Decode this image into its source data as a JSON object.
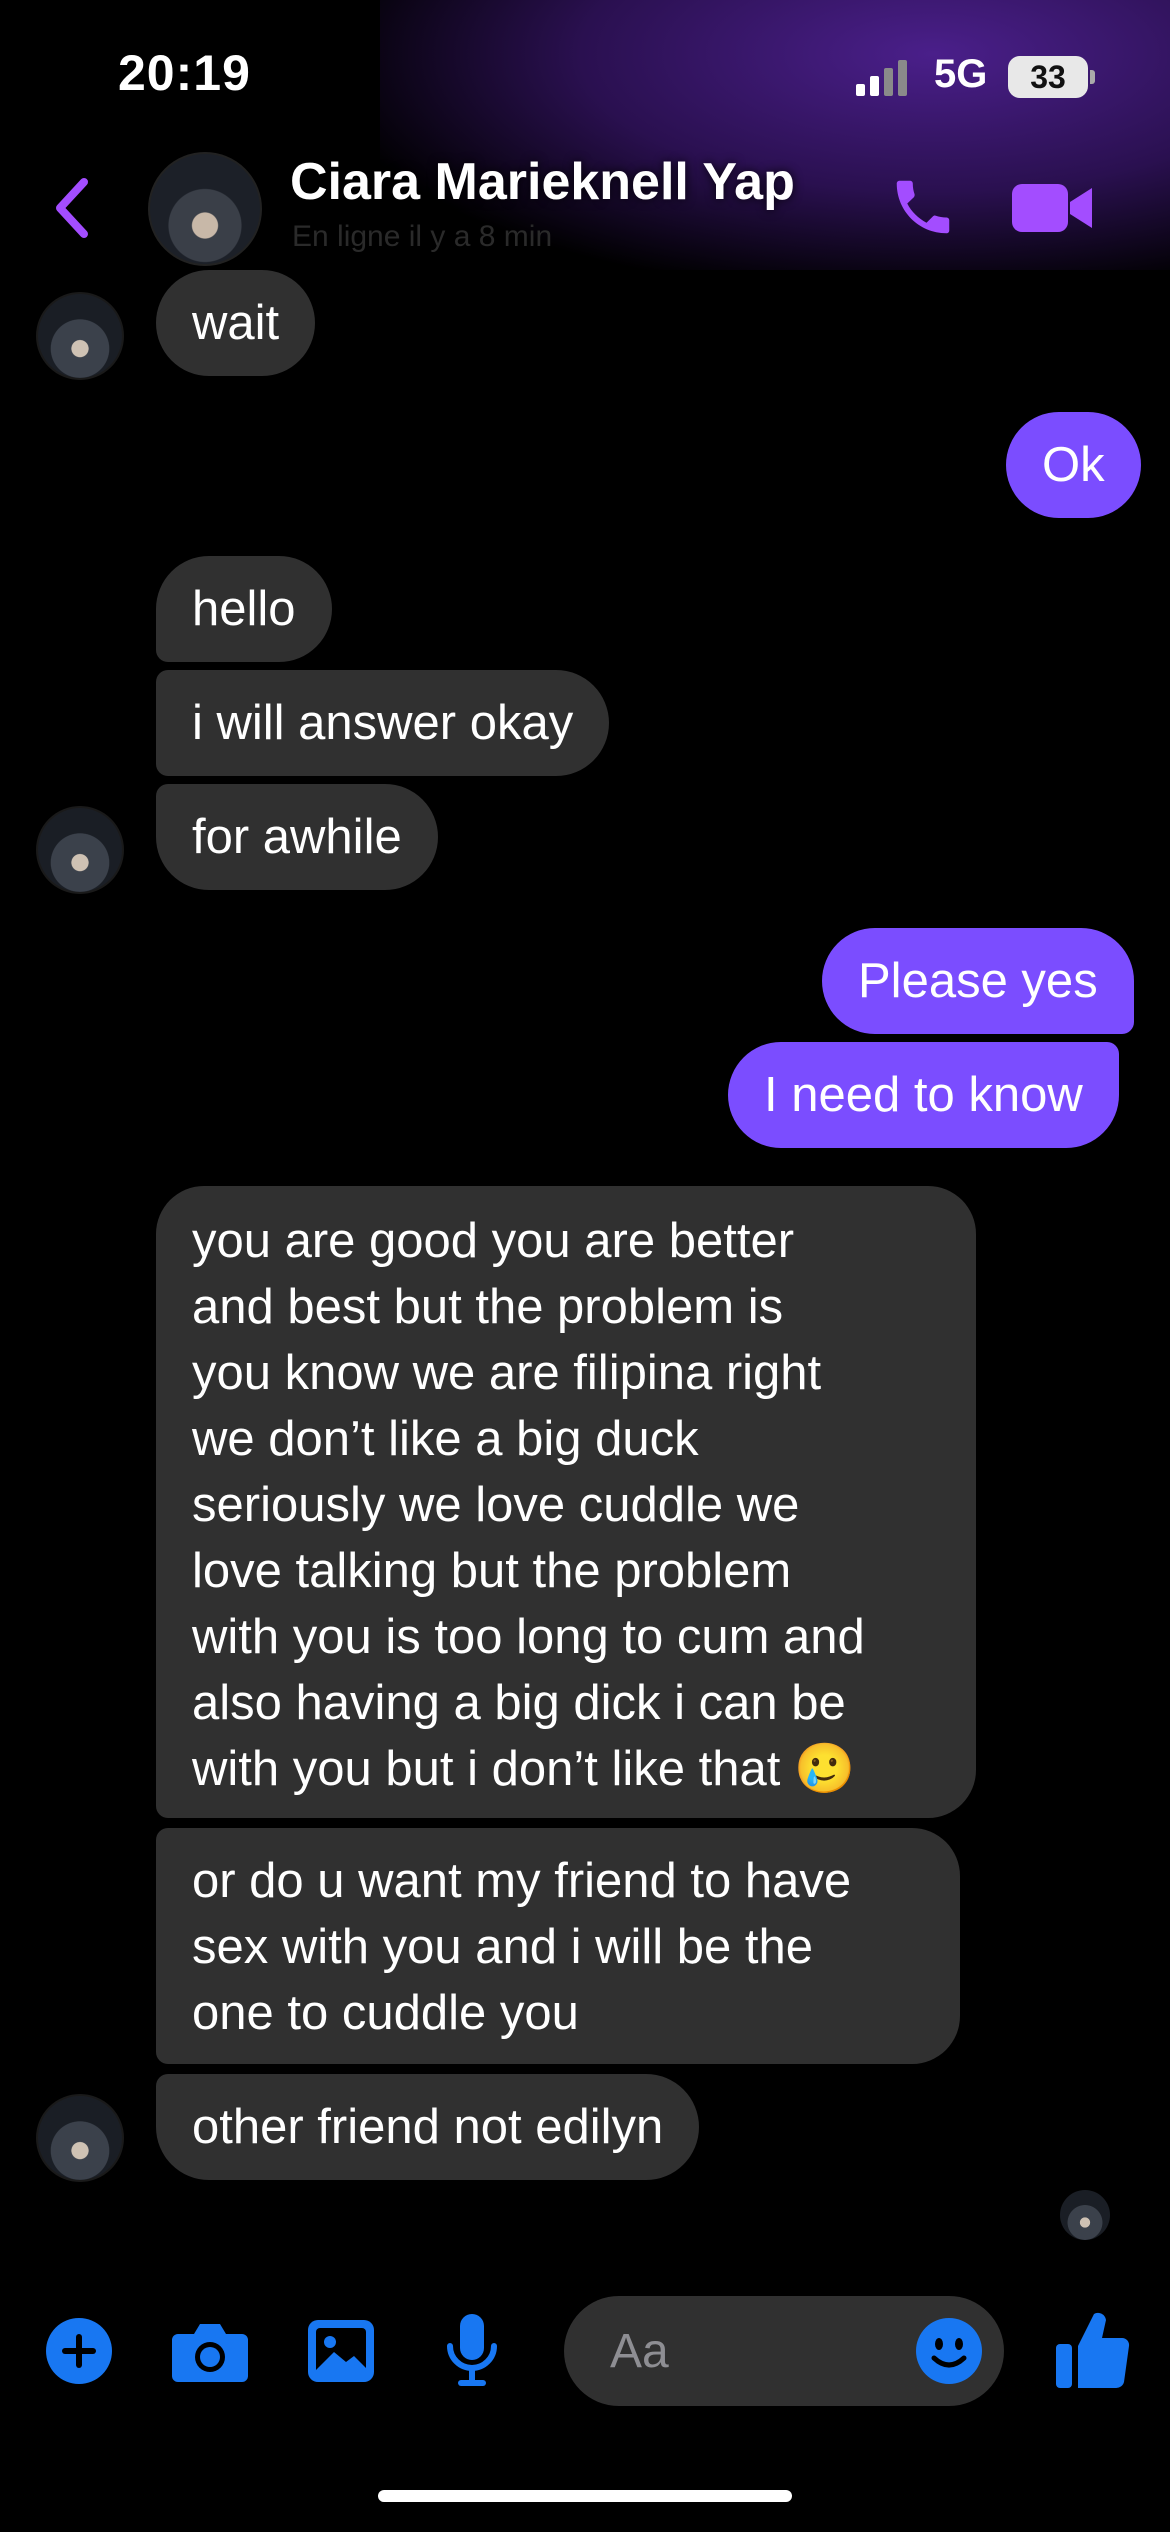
{
  "status_bar": {
    "time": "20:19",
    "network": "5G",
    "battery": "33"
  },
  "header": {
    "contact_name": "Ciara Marieknell Yap",
    "subtitle": "En ligne il y a 8 min"
  },
  "messages": [
    {
      "side": "in",
      "text": "wait"
    },
    {
      "side": "out",
      "text": "Ok"
    },
    {
      "side": "in",
      "text": "hello"
    },
    {
      "side": "in",
      "text": "i will answer okay"
    },
    {
      "side": "in",
      "text": "for awhile"
    },
    {
      "side": "out",
      "text": "Please yes"
    },
    {
      "side": "out",
      "text": "I need to know"
    },
    {
      "side": "in",
      "text": "you are good you are better\nand best but the problem is\nyou know we are filipina right\nwe don’t like a big duck\nseriously we love cuddle we\nlove talking but the problem\nwith you is too long to cum and\nalso having a big dick i can be\nwith you but i don’t like that 🥲"
    },
    {
      "side": "in",
      "text": "or do u want my friend to have\nsex with you and i will be the\none to cuddle you"
    },
    {
      "side": "in",
      "text": "other friend not edilyn"
    }
  ],
  "composer": {
    "placeholder": "Aa"
  },
  "colors": {
    "accent": "#7b4dff",
    "icon_purple": "#a34dff",
    "toolbar_blue": "#1877f2",
    "incoming_bubble": "#303030"
  },
  "icons": [
    "back-chevron-icon",
    "phone-icon",
    "video-camera-icon",
    "plus-icon",
    "camera-icon",
    "image-icon",
    "microphone-icon",
    "emoji-icon",
    "thumbs-up-icon"
  ]
}
